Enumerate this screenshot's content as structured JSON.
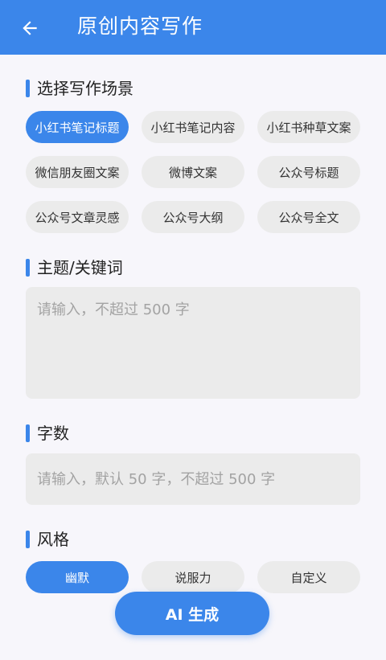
{
  "header": {
    "title": "原创内容写作",
    "back_icon": "arrow-left-icon"
  },
  "sections": {
    "scene_title": "选择写作场景",
    "keyword_title": "主题/关键词",
    "count_title": "字数",
    "style_title": "风格"
  },
  "scenes": [
    {
      "label": "小红书笔记标题",
      "selected": true
    },
    {
      "label": "小红书笔记内容",
      "selected": false
    },
    {
      "label": "小红书种草文案",
      "selected": false
    },
    {
      "label": "微信朋友圈文案",
      "selected": false
    },
    {
      "label": "微博文案",
      "selected": false
    },
    {
      "label": "公众号标题",
      "selected": false
    },
    {
      "label": "公众号文章灵感",
      "selected": false
    },
    {
      "label": "公众号大纲",
      "selected": false
    },
    {
      "label": "公众号全文",
      "selected": false
    }
  ],
  "keyword_input": {
    "value": "",
    "placeholder": "请输入，不超过 500 字"
  },
  "count_input": {
    "value": "",
    "placeholder": "请输入，默认 50 字，不超过 500 字"
  },
  "styles": [
    {
      "label": "幽默",
      "selected": true
    },
    {
      "label": "说服力",
      "selected": false
    },
    {
      "label": "自定义",
      "selected": false
    }
  ],
  "generate_button": {
    "label": "AI 生成"
  },
  "colors": {
    "accent": "#3b86ea",
    "chip_bg": "#ebebeb",
    "page_bg": "#f7f6fb"
  }
}
